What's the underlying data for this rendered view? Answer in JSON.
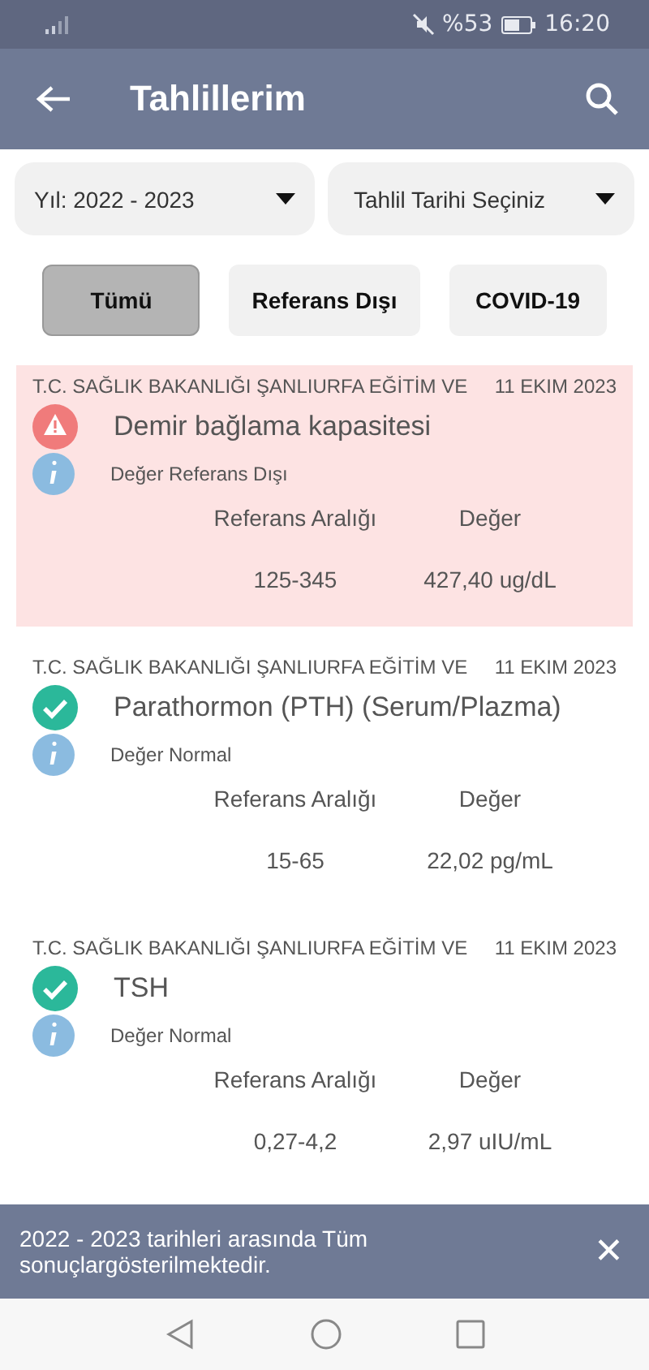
{
  "status_bar": {
    "battery_text": "%53",
    "time": "16:20"
  },
  "header": {
    "title": "Tahlillerim"
  },
  "filters": [
    {
      "label": "Yıl: 2022 - 2023"
    },
    {
      "label": "Tahlil Tarihi Seçiniz"
    }
  ],
  "tabs": [
    {
      "label": "Tümü",
      "selected": true
    },
    {
      "label": "Referans Dışı",
      "selected": false
    },
    {
      "label": "COVID-19",
      "selected": false
    }
  ],
  "results": [
    {
      "hospital": "T.C. SAĞLIK BAKANLIĞI ŞANLIURFA EĞİTİM VE",
      "date": "11 EKIM 2023",
      "kind": "out",
      "name": "Demir bağlama kapasitesi",
      "status": "Değer Referans Dışı",
      "range_label": "Referans Aralığı",
      "value_label": "Değer",
      "range": "125-345",
      "value": "427,40 ug/dL"
    },
    {
      "hospital": "T.C. SAĞLIK BAKANLIĞI ŞANLIURFA EĞİTİM VE",
      "date": "11 EKIM 2023",
      "kind": "normal",
      "name": "Parathormon (PTH) (Serum/Plazma)",
      "status": "Değer Normal",
      "range_label": "Referans Aralığı",
      "value_label": "Değer",
      "range": "15-65",
      "value": "22,02 pg/mL"
    },
    {
      "hospital": "T.C. SAĞLIK BAKANLIĞI ŞANLIURFA EĞİTİM VE",
      "date": "11 EKIM 2023",
      "kind": "normal",
      "name": "TSH",
      "status": "Değer Normal",
      "range_label": "Referans Aralığı",
      "value_label": "Değer",
      "range": "0,27-4,2",
      "value": "2,97 uIU/mL"
    }
  ],
  "snackbar": {
    "message": "2022 - 2023 tarihleri arasında Tüm sonuçlargösterilmektedir.",
    "close": "✕"
  }
}
